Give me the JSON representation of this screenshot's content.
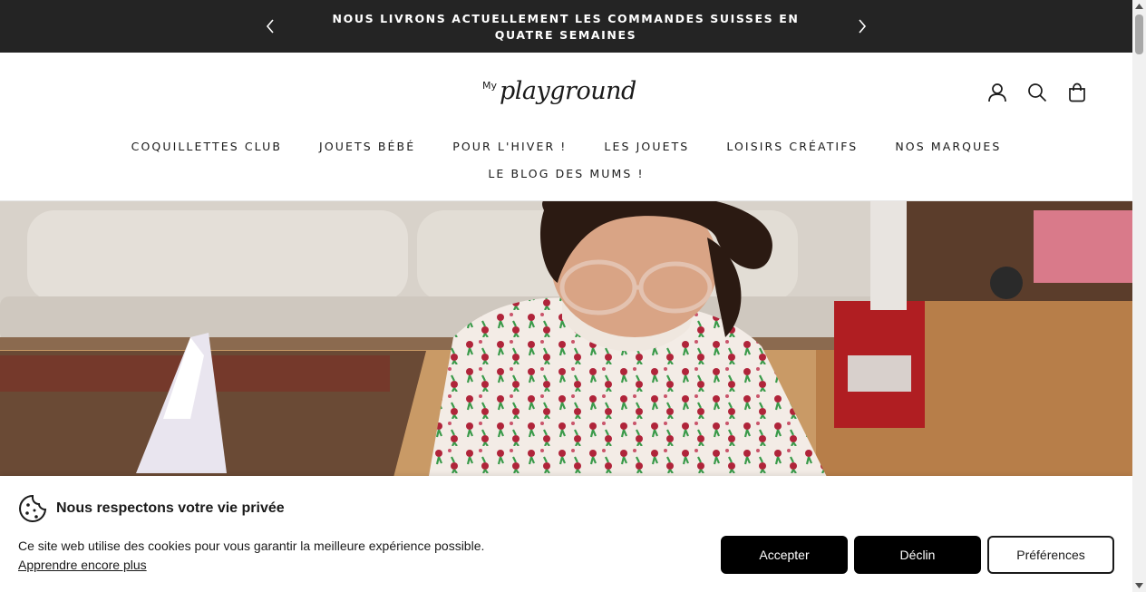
{
  "announcement": {
    "message": "NOUS LIVRONS ACTUELLEMENT LES COMMANDES SUISSES EN QUATRE SEMAINES",
    "prev_icon": "chevron-left-icon",
    "next_icon": "chevron-right-icon"
  },
  "header": {
    "logo_text": "My playground",
    "logo_small": "My",
    "logo_main": "playground",
    "icons": [
      "account-icon",
      "search-icon",
      "cart-bag-icon"
    ]
  },
  "nav": {
    "row1": [
      {
        "label": "COQUILLETTES CLUB"
      },
      {
        "label": "JOUETS BÉBÉ"
      },
      {
        "label": "POUR L'HIVER !"
      },
      {
        "label": "LES JOUETS"
      },
      {
        "label": "LOISIRS CRÉATIFS"
      },
      {
        "label": "NOS MARQUES"
      }
    ],
    "row2": [
      {
        "label": "LE BLOG DES MUMS !"
      }
    ]
  },
  "hero": {
    "image": "child-with-glasses-playing-photo"
  },
  "cookie_banner": {
    "icon": "cookie-icon",
    "title": "Nous respectons votre vie privée",
    "text": "Ce site web utilise des cookies pour vous garantir la meilleure expérience possible.",
    "link": "Apprendre encore plus",
    "accept_label": "Accepter",
    "decline_label": "Déclin",
    "preferences_label": "Préférences"
  },
  "colors": {
    "announcement_bg": "#242424",
    "button_dark": "#000000",
    "text": "#1a1a1a"
  }
}
